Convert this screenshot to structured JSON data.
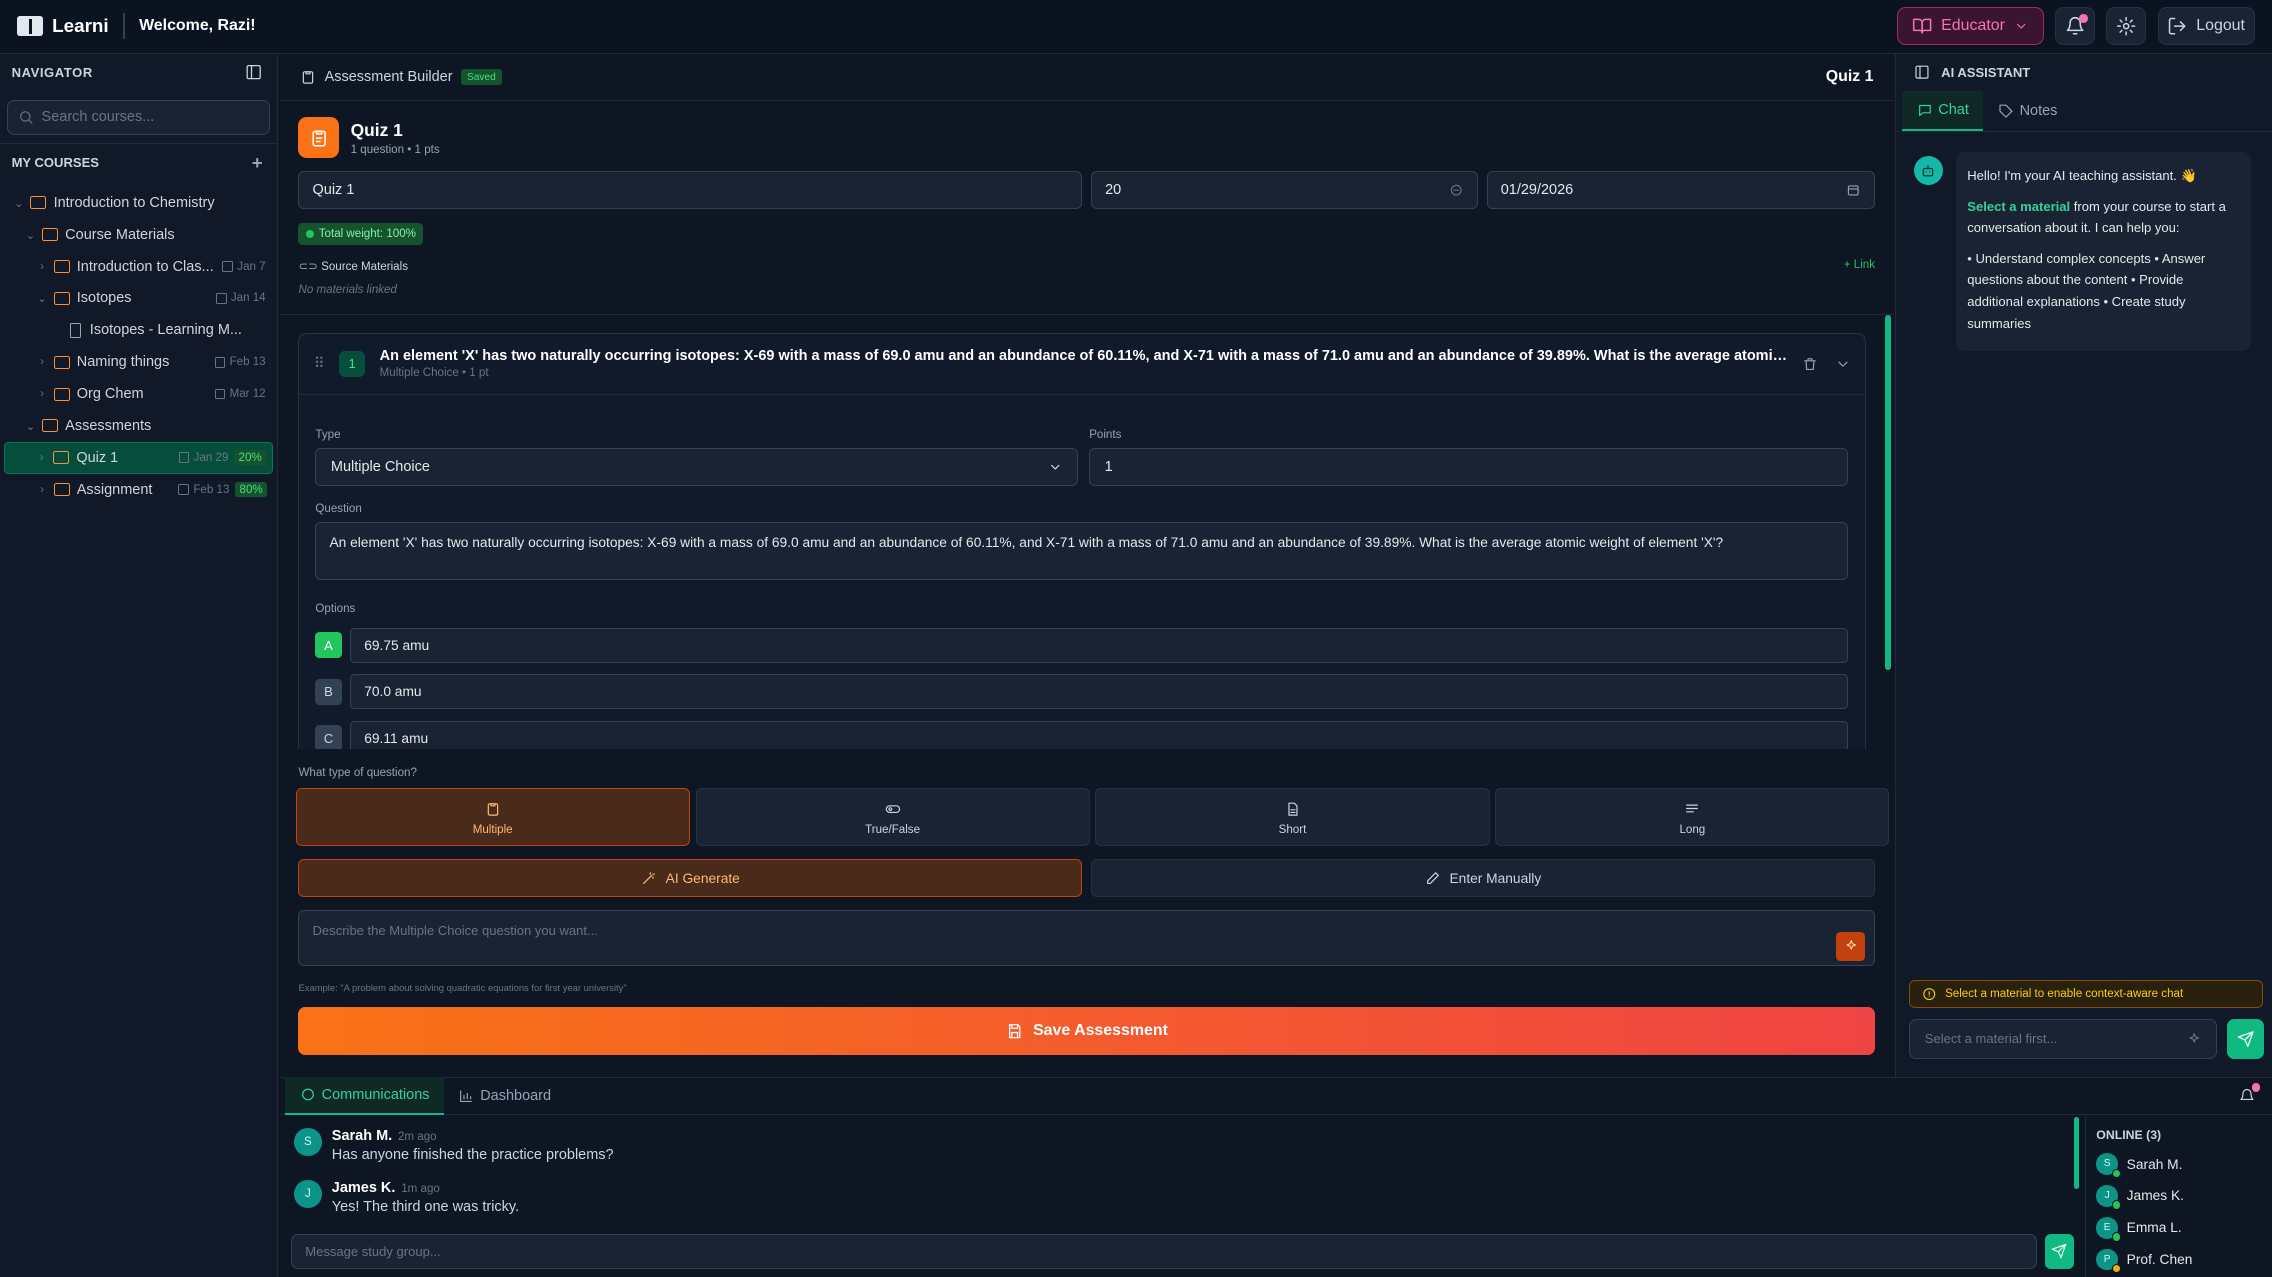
{
  "header": {
    "app_name": "Learni",
    "welcome": "Welcome, Razi!",
    "role_label": "Educator",
    "logout_label": "Logout",
    "accent": "#f472b6"
  },
  "navigator": {
    "title": "NAVIGATOR",
    "search_placeholder": "Search courses...",
    "my_courses": "MY COURSES",
    "tree": [
      {
        "label": "Introduction to Chemistry",
        "date": "",
        "pct": ""
      },
      {
        "label": "Course Materials",
        "date": "",
        "pct": ""
      },
      {
        "label": "Introduction to Clas...",
        "date": "Jan 7",
        "pct": ""
      },
      {
        "label": "Isotopes",
        "date": "Jan 14",
        "pct": ""
      },
      {
        "label": "Isotopes - Learning M...",
        "date": "",
        "pct": ""
      },
      {
        "label": "Naming things",
        "date": "Feb 13",
        "pct": ""
      },
      {
        "label": "Org Chem",
        "date": "Mar 12",
        "pct": ""
      },
      {
        "label": "Assessments",
        "date": "",
        "pct": ""
      },
      {
        "label": "Quiz 1",
        "date": "Jan 29",
        "pct": "20%"
      },
      {
        "label": "Assignment",
        "date": "Feb 13",
        "pct": "80%"
      }
    ]
  },
  "builder": {
    "title": "Assessment Builder",
    "saved": "Saved",
    "current": "Quiz 1",
    "quiz_title": "Quiz 1",
    "quiz_meta": "1 question • 1 pts",
    "name_value": "Quiz 1",
    "time_value": "20",
    "date_value": "01/29/2026",
    "total_weight": "Total weight: 100%",
    "source_materials": "Source Materials",
    "no_materials": "No materials linked",
    "link_label": "+ Link",
    "question": {
      "number": "1",
      "title": "An element 'X' has two naturally occurring isotopes: X-69 with a mass of 69.0 amu and an abundance of 60.11%, and X-71 with a mass of 71.0 amu and an abundance of 39.89%. What is the average atomic weight of eleme...",
      "meta": "Multiple Choice • 1 pt",
      "type_label": "Type",
      "type_value": "Multiple Choice",
      "points_label": "Points",
      "points_value": "1",
      "question_label": "Question",
      "question_text": "An element 'X' has two naturally occurring isotopes: X-69 with a mass of 69.0 amu and an abundance of 60.11%, and X-71 with a mass of 71.0 amu and an abundance of 39.89%. What is the average atomic weight of element 'X'?",
      "options_label": "Options",
      "options": [
        {
          "letter": "A",
          "value": "69.75 amu",
          "correct": true
        },
        {
          "letter": "B",
          "value": "70.0 amu",
          "correct": false
        },
        {
          "letter": "C",
          "value": "69.11 amu",
          "correct": false
        }
      ]
    },
    "what_type": "What type of question?",
    "types": [
      {
        "label": "Multiple",
        "active": true
      },
      {
        "label": "True/False",
        "active": false
      },
      {
        "label": "Short",
        "active": false
      },
      {
        "label": "Long",
        "active": false
      }
    ],
    "ai_generate": "AI Generate",
    "enter_manually": "Enter Manually",
    "describe_placeholder": "Describe the Multiple Choice question you want...",
    "example": "Example: \"A problem about solving quadratic equations for first year university\"",
    "save_label": "Save Assessment"
  },
  "assistant": {
    "title": "AI ASSISTANT",
    "tab_chat": "Chat",
    "tab_notes": "Notes",
    "greeting": "Hello! I'm your AI teaching assistant. 👋",
    "select_material": "Select a material",
    "msg_rest": " from your course to start a conversation about it. I can help you:",
    "capabilities": "• Understand complex concepts • Answer questions about the content • Provide additional explanations • Create study summaries",
    "context_warning": "Select a material to enable context-aware chat",
    "input_placeholder": "Select a material first..."
  },
  "bottom": {
    "tab_comms": "Communications",
    "tab_dashboard": "Dashboard",
    "messages": [
      {
        "initial": "S",
        "name": "Sarah M.",
        "time": "2m ago",
        "text": "Has anyone finished the practice problems?"
      },
      {
        "initial": "J",
        "name": "James K.",
        "time": "1m ago",
        "text": "Yes! The third one was tricky."
      }
    ],
    "input_placeholder": "Message study group...",
    "online_title": "ONLINE (3)",
    "online": [
      {
        "initial": "S",
        "name": "Sarah M."
      },
      {
        "initial": "J",
        "name": "James K."
      },
      {
        "initial": "E",
        "name": "Emma L."
      },
      {
        "initial": "P",
        "name": "Prof. Chen"
      }
    ]
  }
}
